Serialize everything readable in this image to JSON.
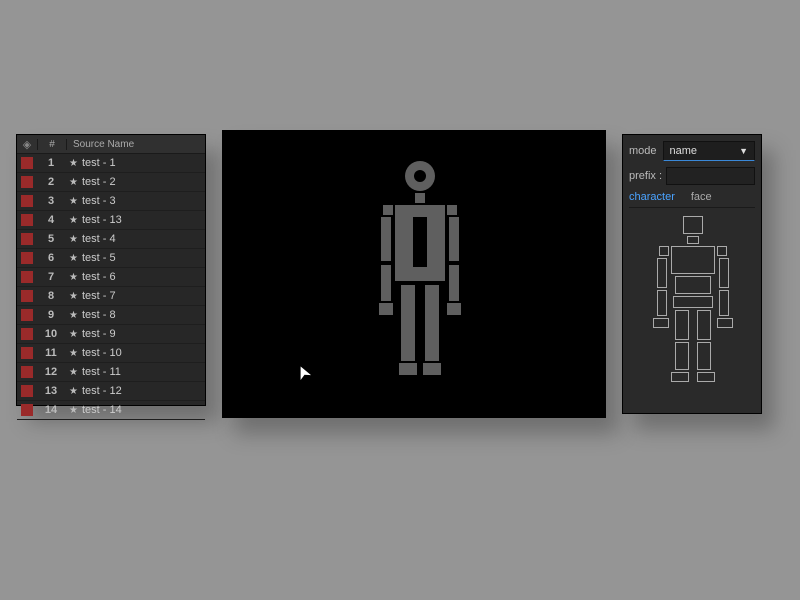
{
  "layer_panel": {
    "header": {
      "tag": "◈",
      "num": "#",
      "name": "Source Name"
    },
    "rows": [
      {
        "num": "1",
        "name": "test - 1"
      },
      {
        "num": "2",
        "name": "test - 2"
      },
      {
        "num": "3",
        "name": "test - 3"
      },
      {
        "num": "4",
        "name": "test - 13"
      },
      {
        "num": "5",
        "name": "test - 4"
      },
      {
        "num": "6",
        "name": "test - 5"
      },
      {
        "num": "7",
        "name": "test - 6"
      },
      {
        "num": "8",
        "name": "test - 7"
      },
      {
        "num": "9",
        "name": "test - 8"
      },
      {
        "num": "10",
        "name": "test - 9"
      },
      {
        "num": "11",
        "name": "test - 10"
      },
      {
        "num": "12",
        "name": "test - 11"
      },
      {
        "num": "13",
        "name": "test - 12"
      },
      {
        "num": "14",
        "name": "test - 14"
      }
    ]
  },
  "options": {
    "mode_label": "mode",
    "mode_value": "name",
    "prefix_label": "prefix :",
    "prefix_value": "",
    "tabs": {
      "character": "character",
      "face": "face"
    }
  }
}
